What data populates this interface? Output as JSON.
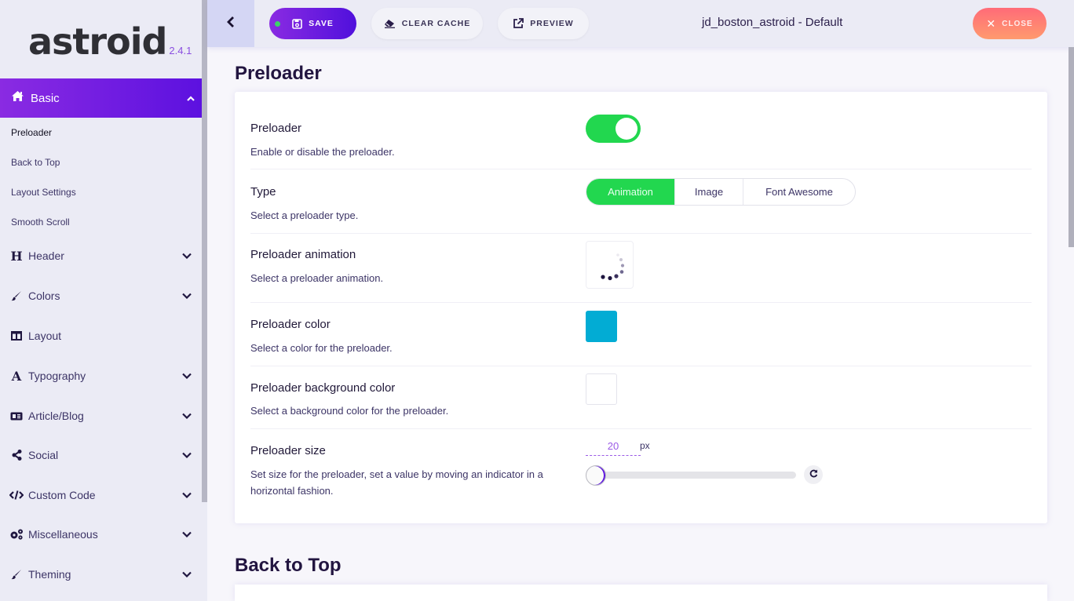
{
  "app": {
    "logo": "astroid",
    "version": "2.4.1",
    "title": "jd_boston_astroid - Default"
  },
  "toolbar": {
    "save_label": "SAVE",
    "clear_cache_label": "CLEAR CACHE",
    "preview_label": "PREVIEW",
    "close_label": "CLOSE"
  },
  "sidebar": {
    "active": {
      "label": "Basic",
      "icon": "home-icon"
    },
    "sub_items": [
      {
        "label": "Preloader"
      },
      {
        "label": "Back to Top"
      },
      {
        "label": "Layout Settings"
      },
      {
        "label": "Smooth Scroll"
      }
    ],
    "items": [
      {
        "label": "Header",
        "icon": "heading-icon",
        "glyph": "H",
        "expandable": true
      },
      {
        "label": "Colors",
        "icon": "brush-icon",
        "glyph": "",
        "expandable": true
      },
      {
        "label": "Layout",
        "icon": "columns-icon",
        "glyph": "",
        "expandable": false
      },
      {
        "label": "Typography",
        "icon": "font-icon",
        "glyph": "A",
        "expandable": true
      },
      {
        "label": "Article/Blog",
        "icon": "newspaper-icon",
        "glyph": "",
        "expandable": true
      },
      {
        "label": "Social",
        "icon": "share-icon",
        "glyph": "",
        "expandable": true
      },
      {
        "label": "Custom Code",
        "icon": "code-icon",
        "glyph": "</>",
        "expandable": true
      },
      {
        "label": "Miscellaneous",
        "icon": "cogs-icon",
        "glyph": "",
        "expandable": true
      },
      {
        "label": "Theming",
        "icon": "brush-icon",
        "glyph": "",
        "expandable": true
      }
    ]
  },
  "main": {
    "section_title": "Preloader",
    "next_section_title": "Back to Top",
    "fields": {
      "preloader": {
        "label": "Preloader",
        "desc": "Enable or disable the preloader.",
        "enabled": true
      },
      "type": {
        "label": "Type",
        "desc": "Select a preloader type.",
        "options": [
          "Animation",
          "Image",
          "Font Awesome"
        ],
        "selected": "Animation"
      },
      "animation": {
        "label": "Preloader animation",
        "desc": "Select a preloader animation."
      },
      "color": {
        "label": "Preloader color",
        "desc": "Select a color for the preloader.",
        "value": "#02acd4"
      },
      "bg_color": {
        "label": "Preloader background color",
        "desc": "Select a background color for the preloader.",
        "value": "#ffffff"
      },
      "size": {
        "label": "Preloader size",
        "desc": "Set size for the preloader, set a value by moving an indicator in a horizontal fashion.",
        "value": "20",
        "unit": "px"
      }
    }
  },
  "colors": {
    "accent": "#5b10e0",
    "toggle_on": "#22d74f",
    "close": "#ff7a72"
  }
}
